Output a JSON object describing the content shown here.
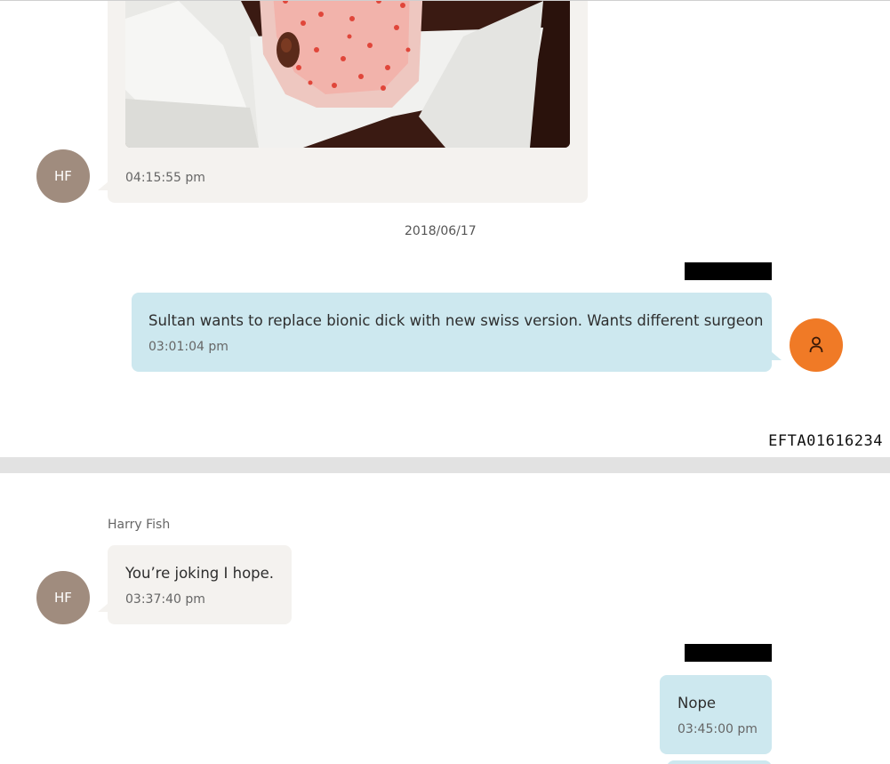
{
  "top_page": {
    "photo_message": {
      "avatar_initials": "HF",
      "time": "04:15:55 pm"
    },
    "date_separator": "2018/06/17",
    "outgoing_message": {
      "text": "Sultan wants to replace bionic dick with new swiss version. Wants different surgeon",
      "time": "03:01:04 pm",
      "avatar_icon": "person-icon"
    },
    "bates_number": "EFTA01616234"
  },
  "bottom_page": {
    "sender_name": "Harry Fish",
    "incoming_message": {
      "avatar_initials": "HF",
      "text": "You’re joking I hope.",
      "time": "03:37:40 pm"
    },
    "outgoing_message": {
      "text": "Nope",
      "time": "03:45:00 pm"
    }
  },
  "colors": {
    "incoming_bubble": "#f4f2ef",
    "outgoing_bubble": "#cde8ef",
    "hf_avatar": "#a08c7e",
    "user_avatar": "#f07a26",
    "page_separator": "#e2e2e2"
  }
}
